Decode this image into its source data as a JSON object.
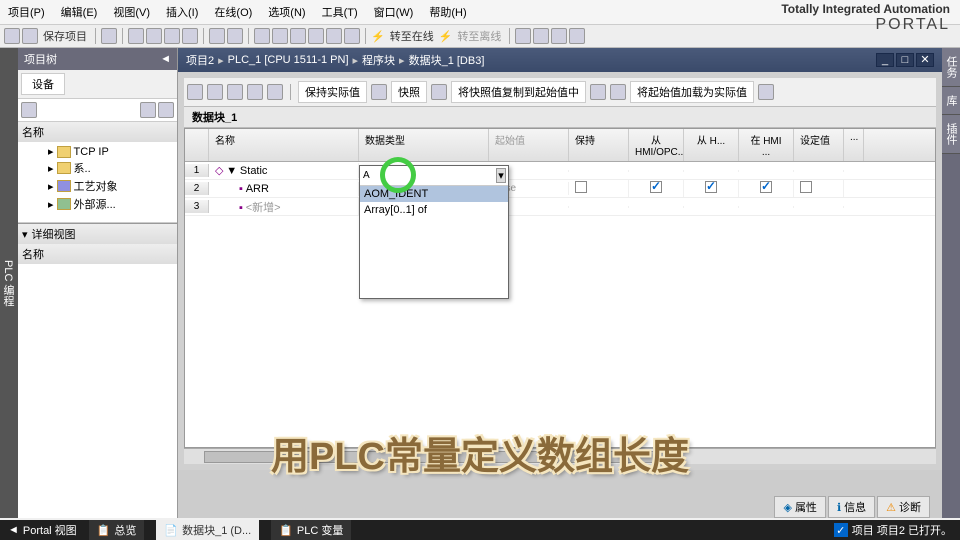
{
  "menu": [
    "项目(P)",
    "编辑(E)",
    "视图(V)",
    "插入(I)",
    "在线(O)",
    "选项(N)",
    "工具(T)",
    "窗口(W)",
    "帮助(H)"
  ],
  "brand": {
    "title": "Totally Integrated Automation",
    "sub": "PORTAL"
  },
  "toolbar": {
    "save": "保存项目",
    "goOnline": "转至在线",
    "goOffline": "转至离线"
  },
  "projectTree": {
    "title": "项目树",
    "tab": "设备",
    "nameHeader": "名称",
    "items": [
      "TCP IP",
      "系..",
      "工艺对象",
      "外部源..."
    ],
    "detail": "详细视图",
    "detailName": "名称"
  },
  "leftTab": "PLC 编程",
  "breadcrumb": [
    "项目2",
    "PLC_1 [CPU 1511-1 PN]",
    "程序块",
    "数据块_1 [DB3]"
  ],
  "editorToolbar": {
    "keepActual": "保持实际值",
    "snapshot": "快照",
    "copySnapshot": "将快照值复制到起始值中",
    "loadStart": "将起始值加载为实际值"
  },
  "blockTitle": "数据块_1",
  "gridCols": [
    "名称",
    "数据类型",
    "起始值",
    "保持",
    "从 HMI/OPC..",
    "从 H...",
    "在 HMI ...",
    "设定值",
    "..."
  ],
  "gridRows": [
    {
      "num": "1",
      "name": "Static",
      "indent": 0,
      "expand": "▼"
    },
    {
      "num": "2",
      "name": "ARR",
      "indent": 1,
      "type": "A",
      "init": "false",
      "hmi1": true,
      "hmi2": true,
      "hmi3": true
    },
    {
      "num": "3",
      "name": "<新增>",
      "indent": 1,
      "gray": true
    }
  ],
  "dropdown": {
    "input": "A",
    "items": [
      "AOM_IDENT",
      "Array[0..1] of"
    ]
  },
  "rightTabs": [
    "任务",
    "库",
    "插件"
  ],
  "bottomTabs": [
    "属性",
    "信息",
    "诊断"
  ],
  "status": {
    "portal": "Portal 视图",
    "overview": "总览",
    "block": "数据块_1 (D...",
    "plcvar": "PLC 变量",
    "project": "项目 项目2 已打开。"
  },
  "overlay": "用PLC常量定义数组长度"
}
